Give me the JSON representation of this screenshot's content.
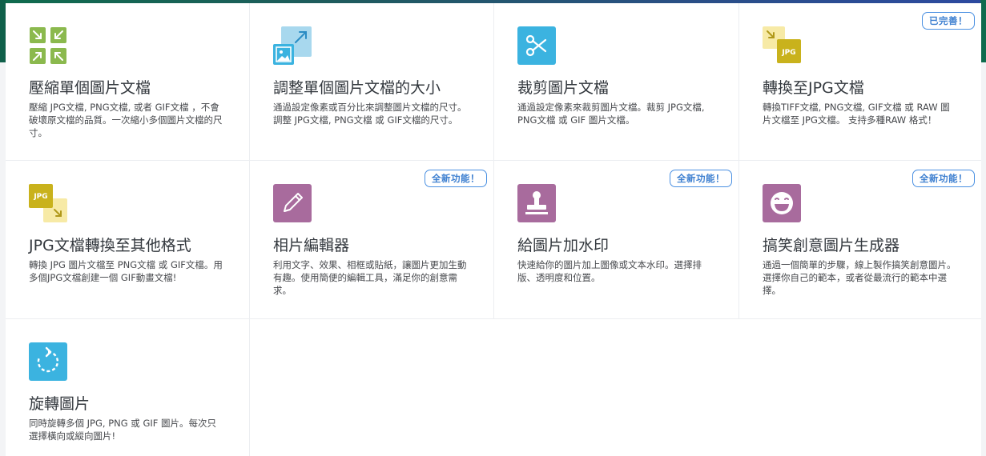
{
  "tools": [
    {
      "title": "壓縮單個圖片文檔",
      "desc": "壓縮 JPG文檔, PNG文檔, 或者 GIF文檔 ，不會破壞原文檔的品質。一次縮小多個圖片文檔的尺寸。",
      "icon": "compress-icon",
      "badge": ""
    },
    {
      "title": "調整單個圖片文檔的大小",
      "desc": "通過設定像素或百分比來調整圖片文檔的尺寸。 調整 JPG文檔, PNG文檔 或 GIF文檔的尺寸。",
      "icon": "resize-icon",
      "badge": ""
    },
    {
      "title": "裁剪圖片文檔",
      "desc": "通過設定像素來裁剪圖片文檔。裁剪 JPG文檔, PNG文檔 或 GIF 圖片文檔。",
      "icon": "scissors-icon",
      "badge": ""
    },
    {
      "title": "轉換至JPG文檔",
      "desc": "轉換TIFF文檔, PNG文檔, GIF文檔 或 RAW 圖片文檔至 JPG文檔。 支持多種RAW 格式！",
      "icon": "convert-to-jpg-icon",
      "icon_label": "JPG",
      "badge": "已完善！"
    },
    {
      "title": "JPG文檔轉換至其他格式",
      "desc": "轉換 JPG 圖片文檔至 PNG文檔 或 GIF文檔。用多個JPG文檔創建一個 GIF動畫文檔!",
      "icon": "convert-from-jpg-icon",
      "icon_label": "JPG",
      "badge": ""
    },
    {
      "title": "相片編輯器",
      "desc": "利用文字、效果、相框或貼紙，讓圖片更加生動有趣。使用簡便的編輯工具，滿足你的創意需求。",
      "icon": "pencil-icon",
      "badge": "全新功能！"
    },
    {
      "title": "給圖片加水印",
      "desc": "快速給你的圖片加上圖像或文本水印。選擇排版、透明度和位置。",
      "icon": "stamp-icon",
      "badge": "全新功能！"
    },
    {
      "title": "搞笑創意圖片生成器",
      "desc": "通過一個簡單的步驟，線上製作搞笑創意圖片。選擇你自己的範本，或者從最流行的範本中選擇。",
      "icon": "laughing-face-icon",
      "badge": "全新功能！"
    },
    {
      "title": "旋轉圖片",
      "desc": "同時旋轉多個 JPG, PNG 或 GIF 圖片。每次只選擇橫向或縱向圖片!",
      "icon": "rotate-icon",
      "badge": ""
    }
  ],
  "colors": {
    "compress": "#8bb94e",
    "resize": "#a8d8ee",
    "crop": "#3bb3e0",
    "jpg_yellow": "#c9b21c",
    "editor": "#a86b9d",
    "badge_border": "#4a90e2"
  }
}
